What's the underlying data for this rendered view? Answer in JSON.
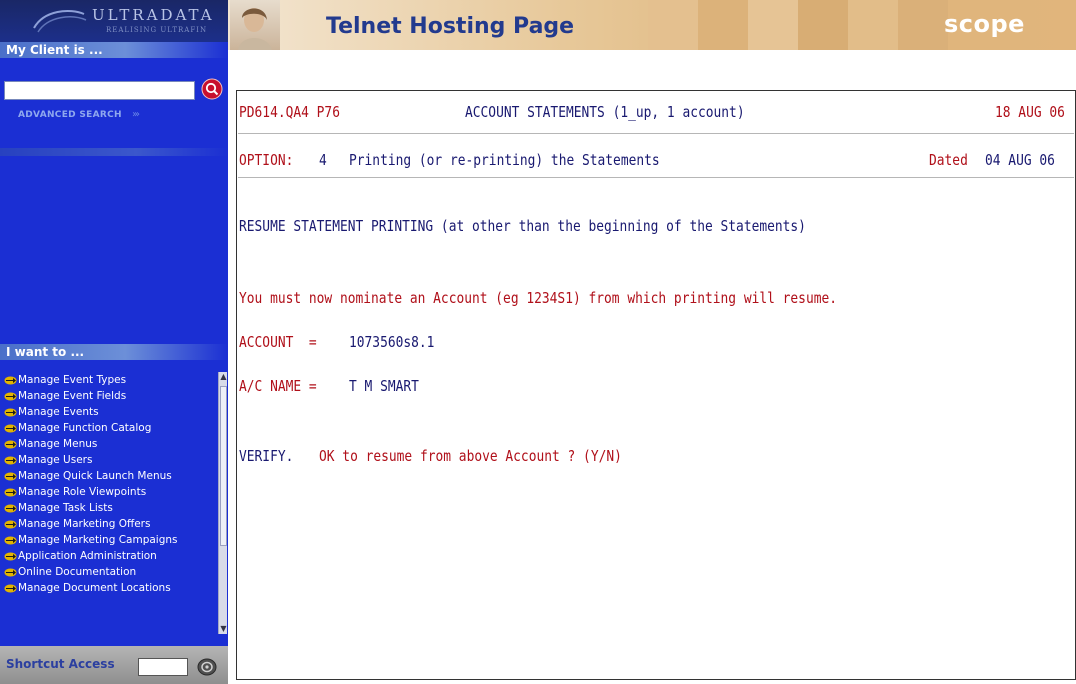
{
  "sidebar": {
    "logo_text": "ULTRADATA",
    "logo_tagline": "REALISING ULTRAFIN",
    "my_client_heading": "My Client is ...",
    "client_search_value": "",
    "advanced_search": "ADVANCED SEARCH",
    "advanced_search_arrows": "›››",
    "i_want_heading": "I want to ...",
    "menu_items": [
      {
        "label": "Manage Event Types"
      },
      {
        "label": "Manage Event Fields"
      },
      {
        "label": "Manage Events"
      },
      {
        "label": "Manage Function Catalog"
      },
      {
        "label": "Manage Menus"
      },
      {
        "label": "Manage Users"
      },
      {
        "label": "Manage Quick Launch Menus"
      },
      {
        "label": "Manage Role Viewpoints"
      },
      {
        "label": "Manage Task Lists"
      },
      {
        "label": "Manage Marketing Offers"
      },
      {
        "label": "Manage Marketing Campaigns"
      },
      {
        "label": "Application Administration"
      },
      {
        "label": "Online Documentation"
      },
      {
        "label": "Manage Document Locations"
      }
    ],
    "shortcut_label": "Shortcut Access",
    "shortcut_value": ""
  },
  "banner": {
    "title": "Telnet Hosting Page",
    "brand": "scope"
  },
  "terminal": {
    "header_code": "PD614.QA4 P76",
    "header_title": "ACCOUNT STATEMENTS (1_up, 1 account)",
    "header_date": "18 AUG 06",
    "option_label": "OPTION:",
    "option_number": "4",
    "option_text": "Printing (or re-printing) the Statements",
    "dated_label": "Dated",
    "dated_value": "04 AUG 06",
    "resume_heading": "RESUME STATEMENT PRINTING (at other than the beginning of the Statements)",
    "nominate_text": "You must now nominate an Account (eg 1234S1) from which printing will resume.",
    "account_label": "ACCOUNT  =",
    "account_value": "1073560s8.1",
    "acname_label": "A/C NAME =",
    "acname_value": "T M SMART",
    "verify_label": "VERIFY.",
    "verify_prompt": "OK to resume from above Account ? (Y/N)"
  },
  "colors": {
    "sidebar_bg": "#1b2fd3",
    "terminal_red": "#b0101a",
    "terminal_navy": "#191970",
    "banner_title": "#223a8e"
  },
  "icons": {
    "client_search": "magnifier-icon",
    "menu_item": "hands-arrow-icon",
    "shortcut_go": "go-icon"
  }
}
